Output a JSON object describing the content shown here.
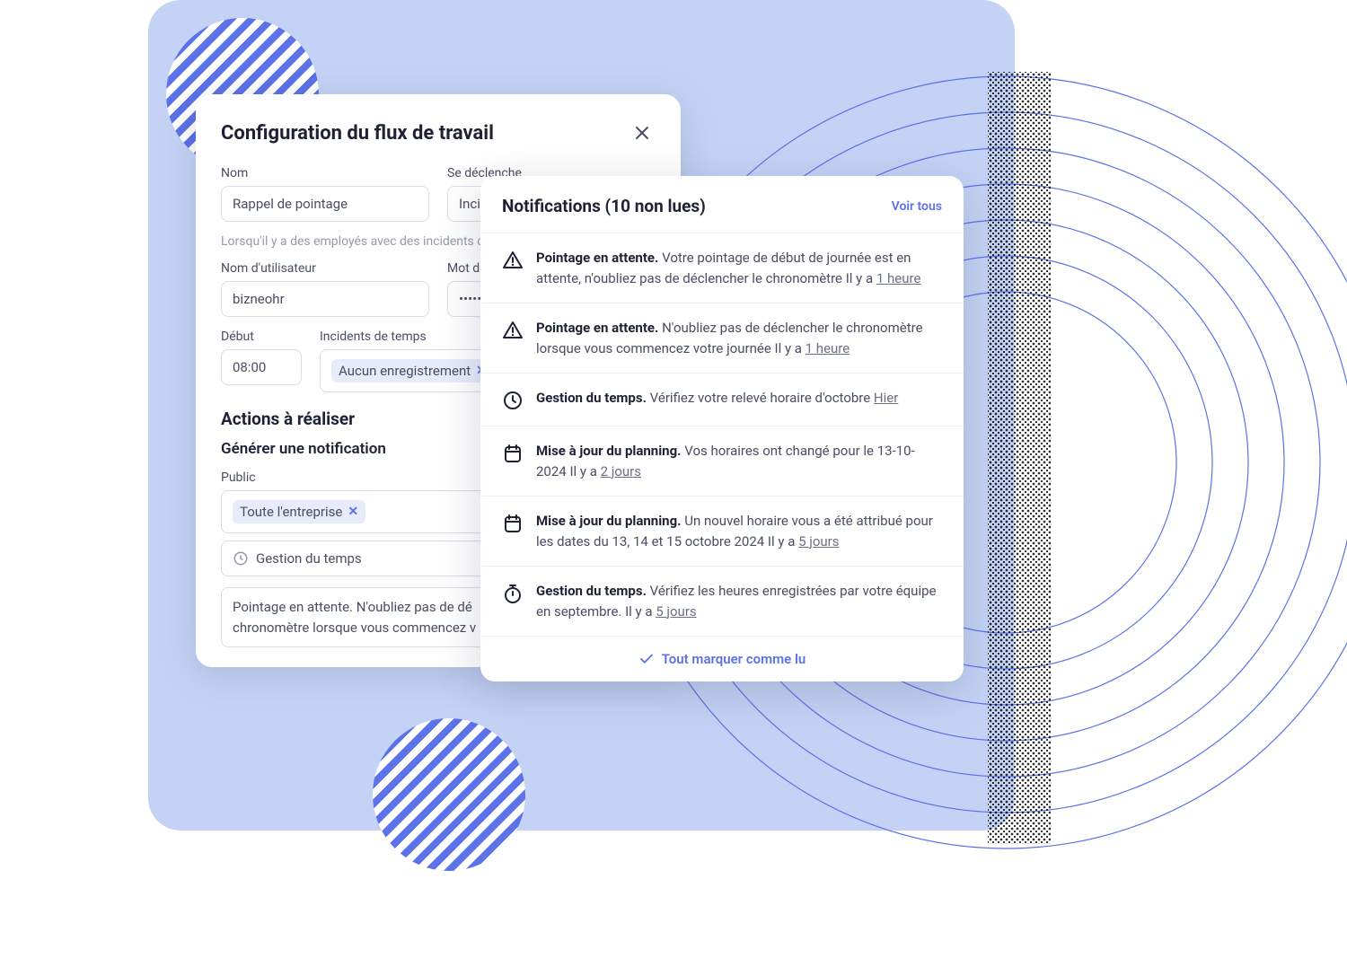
{
  "config": {
    "title": "Configuration du flux de travail",
    "fields": {
      "nom_label": "Nom",
      "nom_value": "Rappel de pointage",
      "trigger_label": "Se déclenche",
      "trigger_value": "Inci",
      "hint": "Lorsqu'il y a des employés avec des incidents c",
      "user_label": "Nom d'utilisateur",
      "user_value": "bizneohr",
      "pass_label": "Mot d",
      "pass_value": "•••••",
      "start_label": "Début",
      "start_value": "08:00",
      "incidents_label": "Incidents de temps",
      "incidents_tag": "Aucun enregistrement"
    },
    "actions_title": "Actions à réaliser",
    "generate_title": "Générer une notification",
    "public_label": "Public",
    "public_tag": "Toute l'entreprise",
    "category_value": "Gestion du temps",
    "message_value": "Pointage en attente. N'oubliez pas de dé\nchronomètre lorsque vous commencez v"
  },
  "notifications": {
    "header": "Notifications (10 non lues)",
    "see_all": "Voir tous",
    "mark_read": "Tout marquer comme lu",
    "items": [
      {
        "icon": "alert",
        "title": "Pointage en attente.",
        "body": "Votre pointage de début de journée est en attente, n'oubliez pas de déclencher le chronomètre Il y a ",
        "time": "1 heure"
      },
      {
        "icon": "alert",
        "title": "Pointage en attente.",
        "body": "N'oubliez pas de déclencher le chronomètre lorsque vous commencez votre journée Il y a ",
        "time": "1 heure"
      },
      {
        "icon": "clock",
        "title": "Gestion du temps.",
        "body": "Vérifiez votre relevé horaire d'octobre ",
        "time": "Hier"
      },
      {
        "icon": "calendar",
        "title": "Mise à jour du planning.",
        "body": "Vos horaires ont changé pour le 13-10-2024 Il y a ",
        "time": "2 jours"
      },
      {
        "icon": "calendar",
        "title": "Mise à jour du planning.",
        "body": "Un nouvel horaire vous a été attribué pour les dates du 13, 14 et 15 octobre 2024 Il y a ",
        "time": "5 jours"
      },
      {
        "icon": "stopwatch",
        "title": "Gestion du temps.",
        "body": "Vérifiez les heures enregistrées par votre équipe en septembre. Il y a ",
        "time": "5 jours"
      }
    ]
  }
}
